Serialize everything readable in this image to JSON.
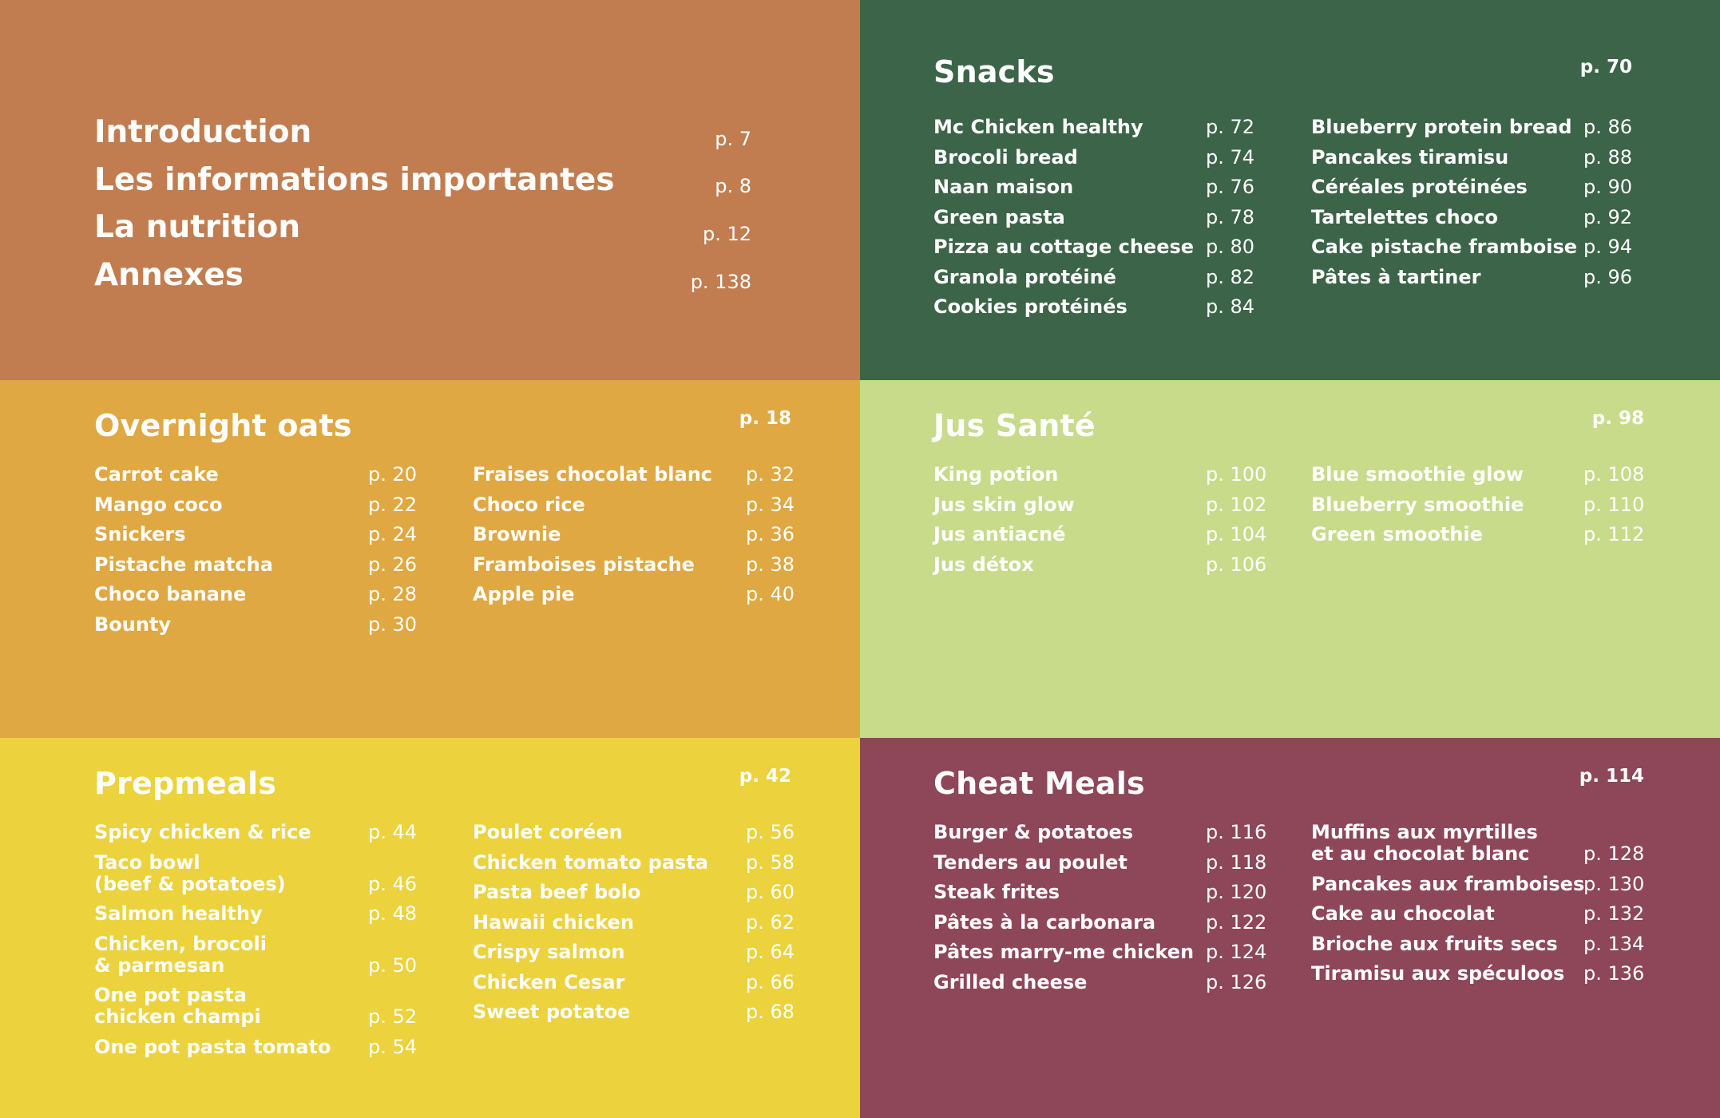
{
  "colors": {
    "intro": "#c17d50",
    "snacks": "#3c6448",
    "oats": "#dfa842",
    "jus": "#c8db8b",
    "prep": "#ecd23d",
    "cheat": "#8e4659",
    "text": "#ffffff"
  },
  "intro": {
    "items": [
      {
        "label": "Introduction",
        "page": "p. 7"
      },
      {
        "label": "Les informations importantes",
        "page": "p. 8"
      },
      {
        "label": "La nutrition",
        "page": "p. 12"
      },
      {
        "label": "Annexes",
        "page": "p. 138"
      }
    ]
  },
  "snacks": {
    "title": "Snacks",
    "page": "p. 70",
    "col1": [
      {
        "label": "Mc Chicken healthy",
        "page": "p. 72"
      },
      {
        "label": "Brocoli bread",
        "page": "p. 74"
      },
      {
        "label": "Naan maison",
        "page": "p. 76"
      },
      {
        "label": "Green pasta",
        "page": "p. 78"
      },
      {
        "label": "Pizza au cottage cheese",
        "page": "p. 80"
      },
      {
        "label": "Granola protéiné",
        "page": "p. 82"
      },
      {
        "label": "Cookies protéinés",
        "page": "p. 84"
      }
    ],
    "col2": [
      {
        "label": "Blueberry protein bread",
        "page": "p. 86"
      },
      {
        "label": "Pancakes tiramisu",
        "page": "p. 88"
      },
      {
        "label": "Céréales protéinées",
        "page": "p. 90"
      },
      {
        "label": "Tartelettes choco",
        "page": "p. 92"
      },
      {
        "label": "Cake pistache framboise",
        "page": "p. 94"
      },
      {
        "label": "Pâtes à tartiner",
        "page": "p. 96"
      }
    ]
  },
  "oats": {
    "title": "Overnight oats",
    "page": "p. 18",
    "col1": [
      {
        "label": "Carrot cake",
        "page": "p. 20"
      },
      {
        "label": "Mango coco",
        "page": "p. 22"
      },
      {
        "label": "Snickers",
        "page": "p. 24"
      },
      {
        "label": "Pistache matcha",
        "page": "p. 26"
      },
      {
        "label": "Choco banane",
        "page": "p. 28"
      },
      {
        "label": "Bounty",
        "page": "p. 30"
      }
    ],
    "col2": [
      {
        "label": "Fraises chocolat blanc",
        "page": "p. 32"
      },
      {
        "label": "Choco rice",
        "page": "p. 34"
      },
      {
        "label": "Brownie",
        "page": "p. 36"
      },
      {
        "label": "Framboises pistache",
        "page": "p. 38"
      },
      {
        "label": "Apple pie",
        "page": "p. 40"
      }
    ]
  },
  "jus": {
    "title": "Jus Santé",
    "page": "p. 98",
    "col1": [
      {
        "label": "King potion",
        "page": "p. 100"
      },
      {
        "label": "Jus skin glow",
        "page": "p. 102"
      },
      {
        "label": "Jus antiacné",
        "page": "p. 104"
      },
      {
        "label": "Jus détox",
        "page": "p. 106"
      }
    ],
    "col2": [
      {
        "label": "Blue smoothie glow",
        "page": "p. 108"
      },
      {
        "label": "Blueberry smoothie",
        "page": "p. 110"
      },
      {
        "label": "Green smoothie",
        "page": "p. 112"
      }
    ]
  },
  "prep": {
    "title": "Prepmeals",
    "page": "p. 42",
    "col1": [
      {
        "label": "Spicy chicken & rice",
        "page": "p. 44"
      },
      {
        "label": "Taco bowl\n(beef & potatoes)",
        "page": "p. 46"
      },
      {
        "label": "Salmon healthy",
        "page": "p. 48"
      },
      {
        "label": "Chicken, brocoli\n& parmesan",
        "page": "p. 50"
      },
      {
        "label": "One pot pasta\nchicken champi",
        "page": "p. 52"
      },
      {
        "label": "One pot pasta tomato",
        "page": "p. 54"
      }
    ],
    "col2": [
      {
        "label": "Poulet coréen",
        "page": "p. 56"
      },
      {
        "label": "Chicken tomato pasta",
        "page": "p. 58"
      },
      {
        "label": "Pasta beef bolo",
        "page": "p. 60"
      },
      {
        "label": "Hawaii chicken",
        "page": "p. 62"
      },
      {
        "label": "Crispy salmon",
        "page": "p. 64"
      },
      {
        "label": "Chicken Cesar",
        "page": "p. 66"
      },
      {
        "label": "Sweet potatoe",
        "page": "p. 68"
      }
    ]
  },
  "cheat": {
    "title": "Cheat Meals",
    "page": "p. 114",
    "col1": [
      {
        "label": "Burger & potatoes",
        "page": "p. 116"
      },
      {
        "label": "Tenders au poulet",
        "page": "p. 118"
      },
      {
        "label": "Steak frites",
        "page": "p. 120"
      },
      {
        "label": "Pâtes à la carbonara",
        "page": "p. 122"
      },
      {
        "label": "Pâtes marry-me chicken",
        "page": "p. 124"
      },
      {
        "label": "Grilled cheese",
        "page": "p. 126"
      }
    ],
    "col2": [
      {
        "label": "Muffins aux myrtilles\net au chocolat blanc",
        "page": "p. 128"
      },
      {
        "label": "Pancakes aux framboises",
        "page": "p. 130"
      },
      {
        "label": "Cake au chocolat",
        "page": "p. 132"
      },
      {
        "label": "Brioche aux fruits secs",
        "page": "p. 134"
      },
      {
        "label": "Tiramisu aux spéculoos",
        "page": "p. 136"
      }
    ]
  }
}
